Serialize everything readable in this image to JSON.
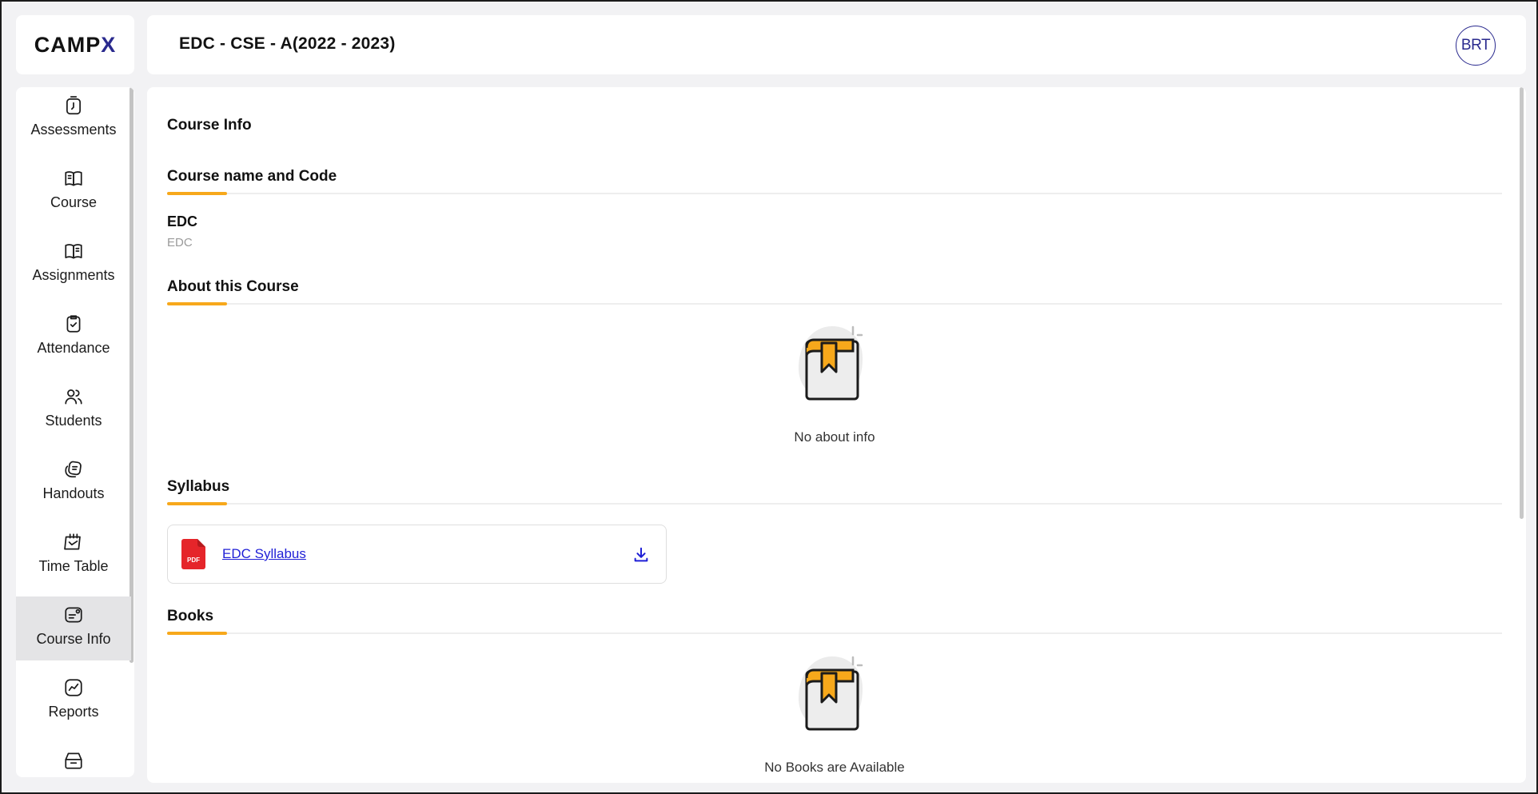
{
  "brand": {
    "logo_main": "CAMP",
    "logo_accent": "X"
  },
  "header": {
    "title": "EDC - CSE - A(2022 - 2023)",
    "avatar": "BRT"
  },
  "sidebar": {
    "items": [
      {
        "label": "Assessments",
        "icon": "stopwatch-icon"
      },
      {
        "label": "Course",
        "icon": "book-open-icon"
      },
      {
        "label": "Assignments",
        "icon": "book-open-icon"
      },
      {
        "label": "Attendance",
        "icon": "clipboard-check-icon"
      },
      {
        "label": "Students",
        "icon": "users-icon"
      },
      {
        "label": "Handouts",
        "icon": "handout-icon"
      },
      {
        "label": "Time Table",
        "icon": "calendar-icon"
      },
      {
        "label": "Course Info",
        "icon": "info-card-icon",
        "active": true
      },
      {
        "label": "Reports",
        "icon": "chart-icon"
      },
      {
        "label": "",
        "icon": "folder-icon"
      }
    ]
  },
  "main": {
    "page_title": "Course Info",
    "sections": {
      "course_name": {
        "title": "Course name and Code",
        "name": "EDC",
        "code": "EDC"
      },
      "about": {
        "title": "About this Course",
        "empty_text": "No about info"
      },
      "syllabus": {
        "title": "Syllabus",
        "file_label": "EDC Syllabus",
        "file_type": "PDF"
      },
      "books": {
        "title": "Books",
        "empty_text": "No Books are Available"
      }
    }
  },
  "colors": {
    "accent": "#f7a81b",
    "brand": "#2a2a8e",
    "link": "#1f1fd6",
    "pdf": "#e5252a",
    "active_bg": "#e4e4e6"
  }
}
